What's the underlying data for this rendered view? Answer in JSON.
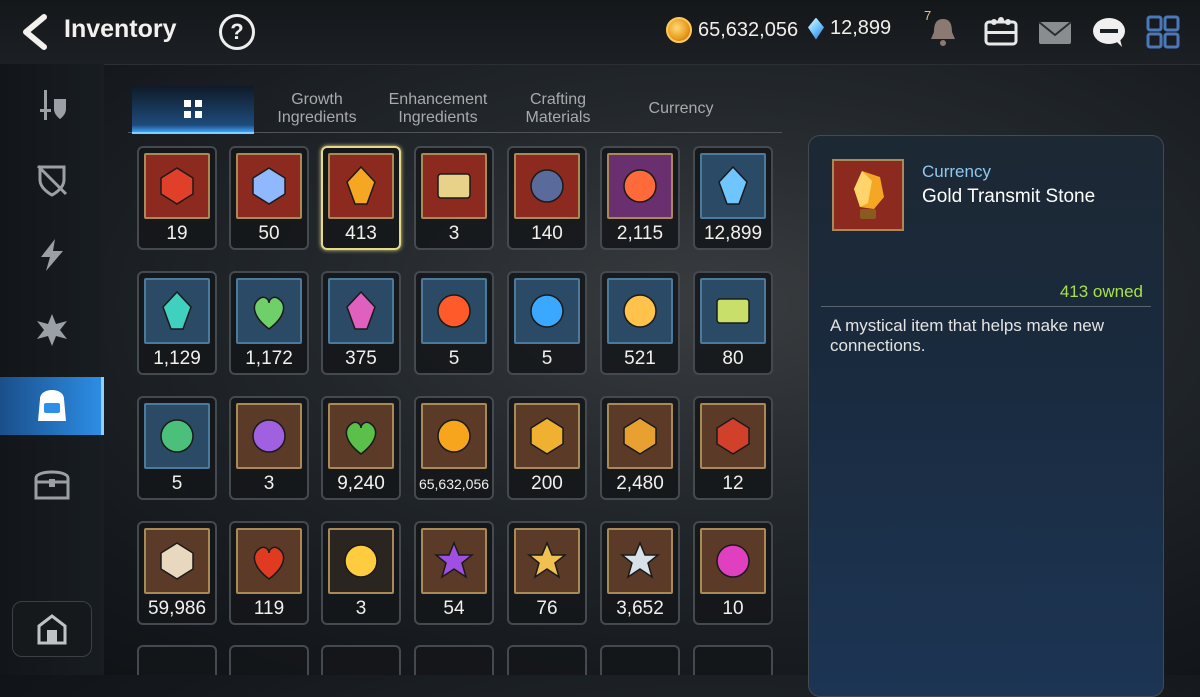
{
  "header": {
    "title": "Inventory",
    "help_label": "?",
    "gold": "65,632,056",
    "crystals": "12,899",
    "notification_count": "7"
  },
  "rail": {
    "items": [
      "equipment",
      "artifact",
      "skill-stone",
      "unit-upgrade",
      "inventory-bag",
      "treasure-chest"
    ],
    "active": "inventory-bag"
  },
  "tabs": [
    {
      "label": "",
      "icon": "grid-icon",
      "active": true
    },
    {
      "label": "Growth Ingredients"
    },
    {
      "label": "Enhancement Ingredients"
    },
    {
      "label": "Crafting Materials"
    },
    {
      "label": "Currency"
    }
  ],
  "items": [
    {
      "count": "19",
      "icon": "red-rune-icon",
      "bg": "#8c2a20"
    },
    {
      "count": "50",
      "icon": "eye-emblem-icon",
      "bg": "#8c2a20"
    },
    {
      "count": "413",
      "icon": "gold-stone-icon",
      "bg": "#8c2a20",
      "selected": true
    },
    {
      "count": "3",
      "icon": "ticket-icon",
      "bg": "#8c2a20"
    },
    {
      "count": "140",
      "icon": "charm-icon",
      "bg": "#8c2a20"
    },
    {
      "count": "2,115",
      "icon": "red-token-icon",
      "bg": "#6a2f6e"
    },
    {
      "count": "12,899",
      "icon": "crystal-icon",
      "bg": "#2a4a66"
    },
    {
      "count": "1,129",
      "icon": "teal-crystal-icon",
      "bg": "#2a4a66"
    },
    {
      "count": "1,172",
      "icon": "leaf-icon",
      "bg": "#2a4a66"
    },
    {
      "count": "375",
      "icon": "pink-ore-icon",
      "bg": "#2a4a66"
    },
    {
      "count": "5",
      "icon": "flame-charm-icon",
      "bg": "#2a4a66"
    },
    {
      "count": "5",
      "icon": "water-charm-icon",
      "bg": "#2a4a66"
    },
    {
      "count": "521",
      "icon": "star-charm-icon",
      "bg": "#2a4a66"
    },
    {
      "count": "80",
      "icon": "card-icon",
      "bg": "#2a4a66"
    },
    {
      "count": "5",
      "icon": "clover-charm-icon",
      "bg": "#2a4a66"
    },
    {
      "count": "3",
      "icon": "sword-seal-icon",
      "bg": "#5b3a28"
    },
    {
      "count": "9,240",
      "icon": "green-heart-icon",
      "bg": "#5b3a28"
    },
    {
      "count": "65,632,056",
      "icon": "gold-coin-icon",
      "bg": "#5b3a28"
    },
    {
      "count": "200",
      "icon": "gold-emblem-icon",
      "bg": "#5b3a28"
    },
    {
      "count": "2,480",
      "icon": "fist-emblem-icon",
      "bg": "#5b3a28"
    },
    {
      "count": "12",
      "icon": "banner-icon",
      "bg": "#5b3a28"
    },
    {
      "count": "59,986",
      "icon": "horse-statue-icon",
      "bg": "#5b3a28"
    },
    {
      "count": "119",
      "icon": "red-leaf-icon",
      "bg": "#5b3a28"
    },
    {
      "count": "3",
      "icon": "phantasma-icon",
      "bg": "#2a2520"
    },
    {
      "count": "54",
      "icon": "purple-flower-icon",
      "bg": "#5b3a28"
    },
    {
      "count": "76",
      "icon": "gold-flower-icon",
      "bg": "#5b3a28"
    },
    {
      "count": "3,652",
      "icon": "silver-flower-icon",
      "bg": "#5b3a28"
    },
    {
      "count": "10",
      "icon": "pink-gem-icon",
      "bg": "#5b3a28"
    }
  ],
  "detail": {
    "category": "Currency",
    "name": "Gold Transmit Stone",
    "owned": "413 owned",
    "description": "A mystical item that helps make new connections."
  }
}
